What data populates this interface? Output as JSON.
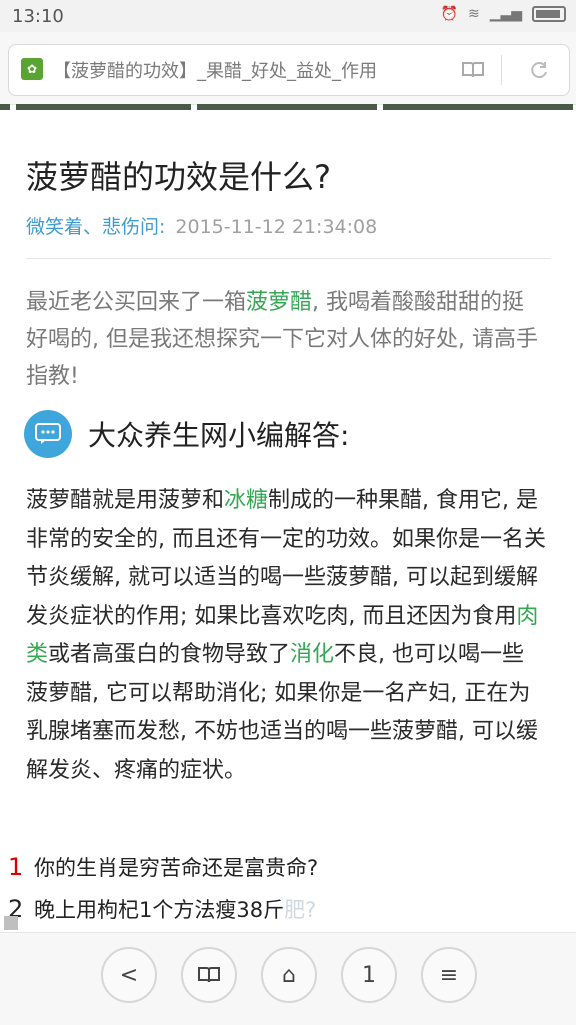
{
  "status": {
    "time": "13:10",
    "icons": [
      "alarm-icon",
      "wifi-icon",
      "signal-icon",
      "battery-icon"
    ]
  },
  "address": {
    "title": "【菠萝醋的功效】_果醋_好处_益处_作用"
  },
  "article": {
    "title": "菠萝醋的功效是什么?",
    "author": "微笑着、悲伤问:",
    "date": "2015-11-12 21:34:08",
    "question": {
      "before": "最近老公买回来了一箱",
      "link": "菠萝醋",
      "after": ", 我喝着酸酸甜甜的挺好喝的, 但是我还想探究一下它对人体的好处, 请高手指教!"
    },
    "answer_label": "大众养生网小编解答:",
    "answer": {
      "p1": "菠萝醋就是用菠萝和",
      "link1": "冰糖",
      "p2": "制成的一种果醋, 食用它, 是非常的安全的, 而且还有一定的功效。如果你是一名关节炎缓解, 就可以适当的喝一些菠萝醋, 可以起到缓解发炎症状的作用; 如果比喜欢吃肉, 而且还因为食用",
      "link2": "肉类",
      "p3": "或者高蛋白的食物导致了",
      "link3": "消化",
      "p4": "不良, 也可以喝一些菠萝醋, 它可以帮助消化; 如果你是一名产妇, 正在为乳腺堵塞而发愁, 不妨也适当的喝一些菠萝醋, 可以缓解发炎、疼痛的症状。"
    }
  },
  "related": [
    {
      "num": "1",
      "text": "你的生肖是穷苦命还是富贵命?"
    },
    {
      "num": "2",
      "text": "晚上用枸杞1个方法瘦38斤",
      "faded": "肥?"
    }
  ],
  "bottom_nav": {
    "back": "<",
    "tabs": "⧉",
    "home": "⌂",
    "window_count": "1",
    "menu": "≡"
  }
}
